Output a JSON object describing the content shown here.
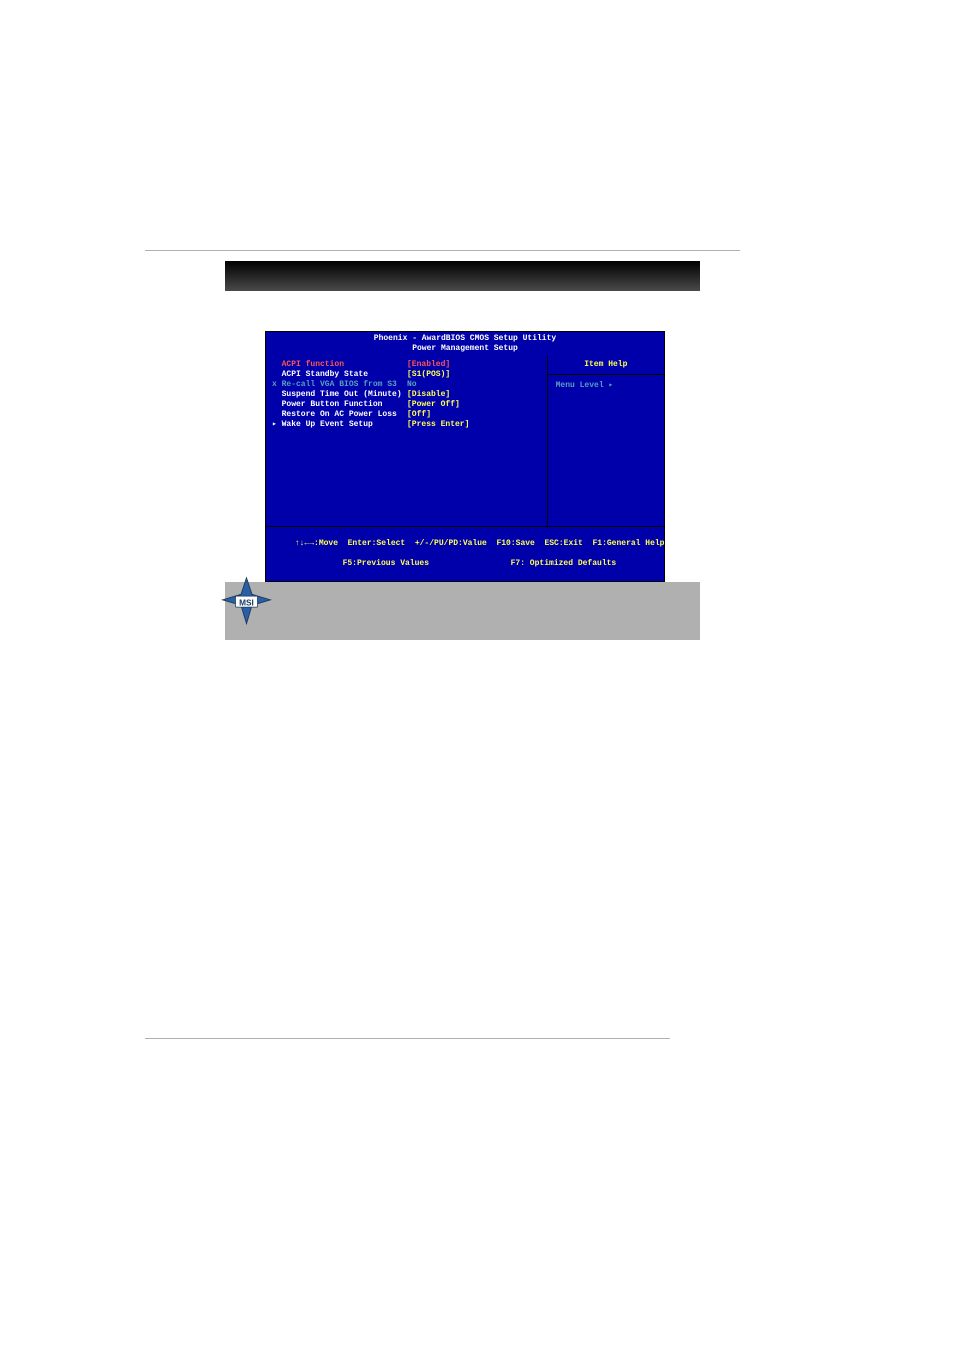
{
  "bios": {
    "title_line1": "Phoenix - AwardBIOS CMOS Setup Utility",
    "title_line2": "Power Management Setup",
    "help_title": "Item Help",
    "menu_level": "Menu Level    ▸",
    "rows": [
      {
        "label": "  ACPI function",
        "value": "[Enabled]",
        "style": "highlight"
      },
      {
        "label": "  ACPI Standby State",
        "value": "[S1(POS)]",
        "style": "normal"
      },
      {
        "label": "x Re-call VGA BIOS from S3",
        "value": "No",
        "style": "dimmed"
      },
      {
        "label": "  Suspend Time Out (Minute)",
        "value": "[Disable]",
        "style": "normal"
      },
      {
        "label": "  Power Button Function",
        "value": "[Power Off]",
        "style": "normal"
      },
      {
        "label": "  Restore On AC Power Loss",
        "value": "[Off]",
        "style": "normal"
      },
      {
        "label": "▸ Wake Up Event Setup",
        "value": "[Press Enter]",
        "style": "normal"
      }
    ],
    "footer_line1": "↑↓←→:Move  Enter:Select  +/-/PU/PD:Value  F10:Save  ESC:Exit  F1:General Help",
    "footer_line2": "F5:Previous Values                 F7: Optimized Defaults"
  },
  "logo_text": "MSI",
  "quote_placeholder": "\"           \""
}
